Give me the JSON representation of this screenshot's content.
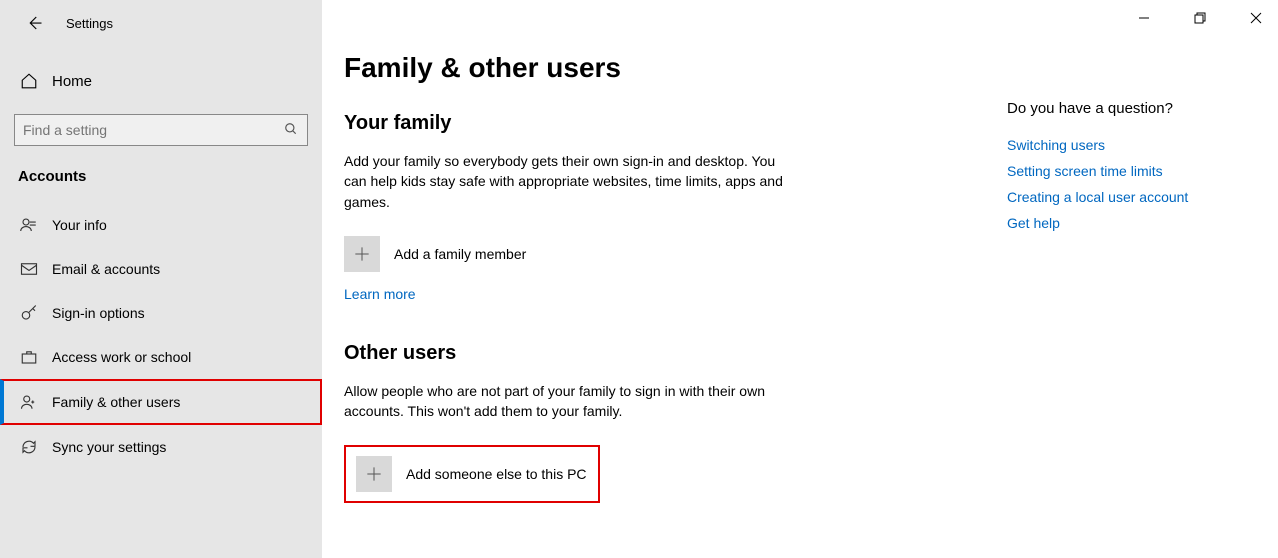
{
  "app_title": "Settings",
  "home_label": "Home",
  "search_placeholder": "Find a setting",
  "category": "Accounts",
  "nav": [
    {
      "label": "Your info"
    },
    {
      "label": "Email & accounts"
    },
    {
      "label": "Sign-in options"
    },
    {
      "label": "Access work or school"
    },
    {
      "label": "Family & other users"
    },
    {
      "label": "Sync your settings"
    }
  ],
  "page_title": "Family & other users",
  "family": {
    "heading": "Your family",
    "desc": "Add your family so everybody gets their own sign-in and desktop. You can help kids stay safe with appropriate websites, time limits, apps and games.",
    "add_label": "Add a family member",
    "learn_more": "Learn more"
  },
  "other": {
    "heading": "Other users",
    "desc": "Allow people who are not part of your family to sign in with their own accounts. This won't add them to your family.",
    "add_label": "Add someone else to this PC"
  },
  "help": {
    "title": "Do you have a question?",
    "links": [
      "Switching users",
      "Setting screen time limits",
      "Creating a local user account",
      "Get help"
    ]
  }
}
